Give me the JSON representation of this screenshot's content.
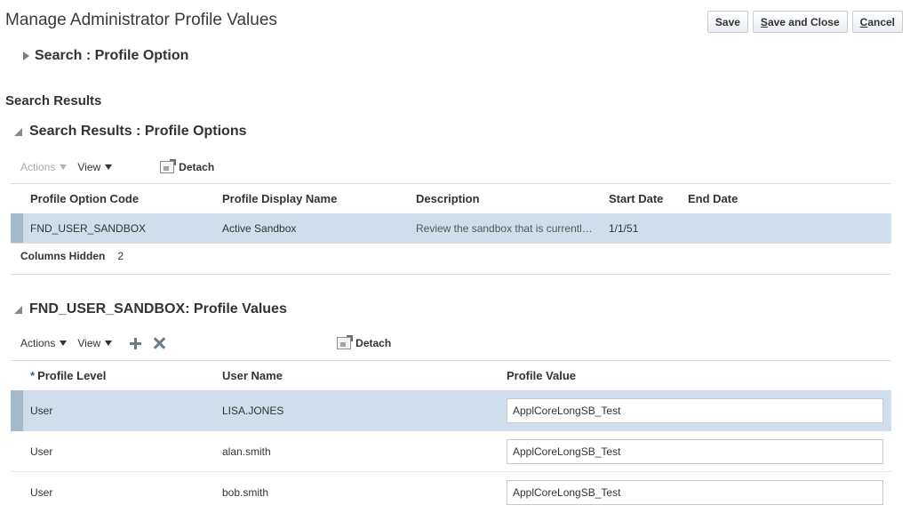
{
  "page": {
    "title": "Manage Administrator Profile Values"
  },
  "buttons": {
    "save": "Save",
    "save_and_close_u": "S",
    "save_and_close_rest": "ave and Close",
    "cancel_u": "C",
    "cancel_rest": "ancel"
  },
  "search": {
    "title": "Search : Profile Option"
  },
  "results": {
    "heading": "Search Results",
    "sub_heading": "Search Results : Profile Options",
    "toolbar": {
      "actions": "Actions",
      "view": "View",
      "detach": "Detach"
    },
    "columns": [
      "Profile Option Code",
      "Profile Display Name",
      "Description",
      "Start Date",
      "End Date"
    ],
    "rows": [
      {
        "code": "FND_USER_SANDBOX",
        "display_name": "Active Sandbox",
        "description": "Review the sandbox that is currentl…",
        "start_date": "1/1/51",
        "end_date": ""
      }
    ],
    "columns_hidden_label": "Columns Hidden",
    "columns_hidden_count": "2"
  },
  "values": {
    "heading": "FND_USER_SANDBOX: Profile Values",
    "toolbar": {
      "actions": "Actions",
      "view": "View",
      "detach": "Detach"
    },
    "required_marker": "*",
    "columns": [
      "Profile Level",
      "User Name",
      "Profile Value"
    ],
    "rows": [
      {
        "level": "User",
        "user": "LISA.JONES",
        "value": "ApplCoreLongSB_Test"
      },
      {
        "level": "User",
        "user": "alan.smith",
        "value": "ApplCoreLongSB_Test"
      },
      {
        "level": "User",
        "user": "bob.smith",
        "value": "ApplCoreLongSB_Test"
      }
    ]
  },
  "icons": {
    "search_disclosure": "triangle-right-icon",
    "results_disclosure": "triangle-down-icon",
    "values_disclosure": "triangle-down-icon",
    "add": "plus-icon",
    "delete": "x-icon",
    "detach": "detach-icon"
  },
  "colors": {
    "selected_row": "#cfdeea",
    "required": "#1e6fb3"
  }
}
